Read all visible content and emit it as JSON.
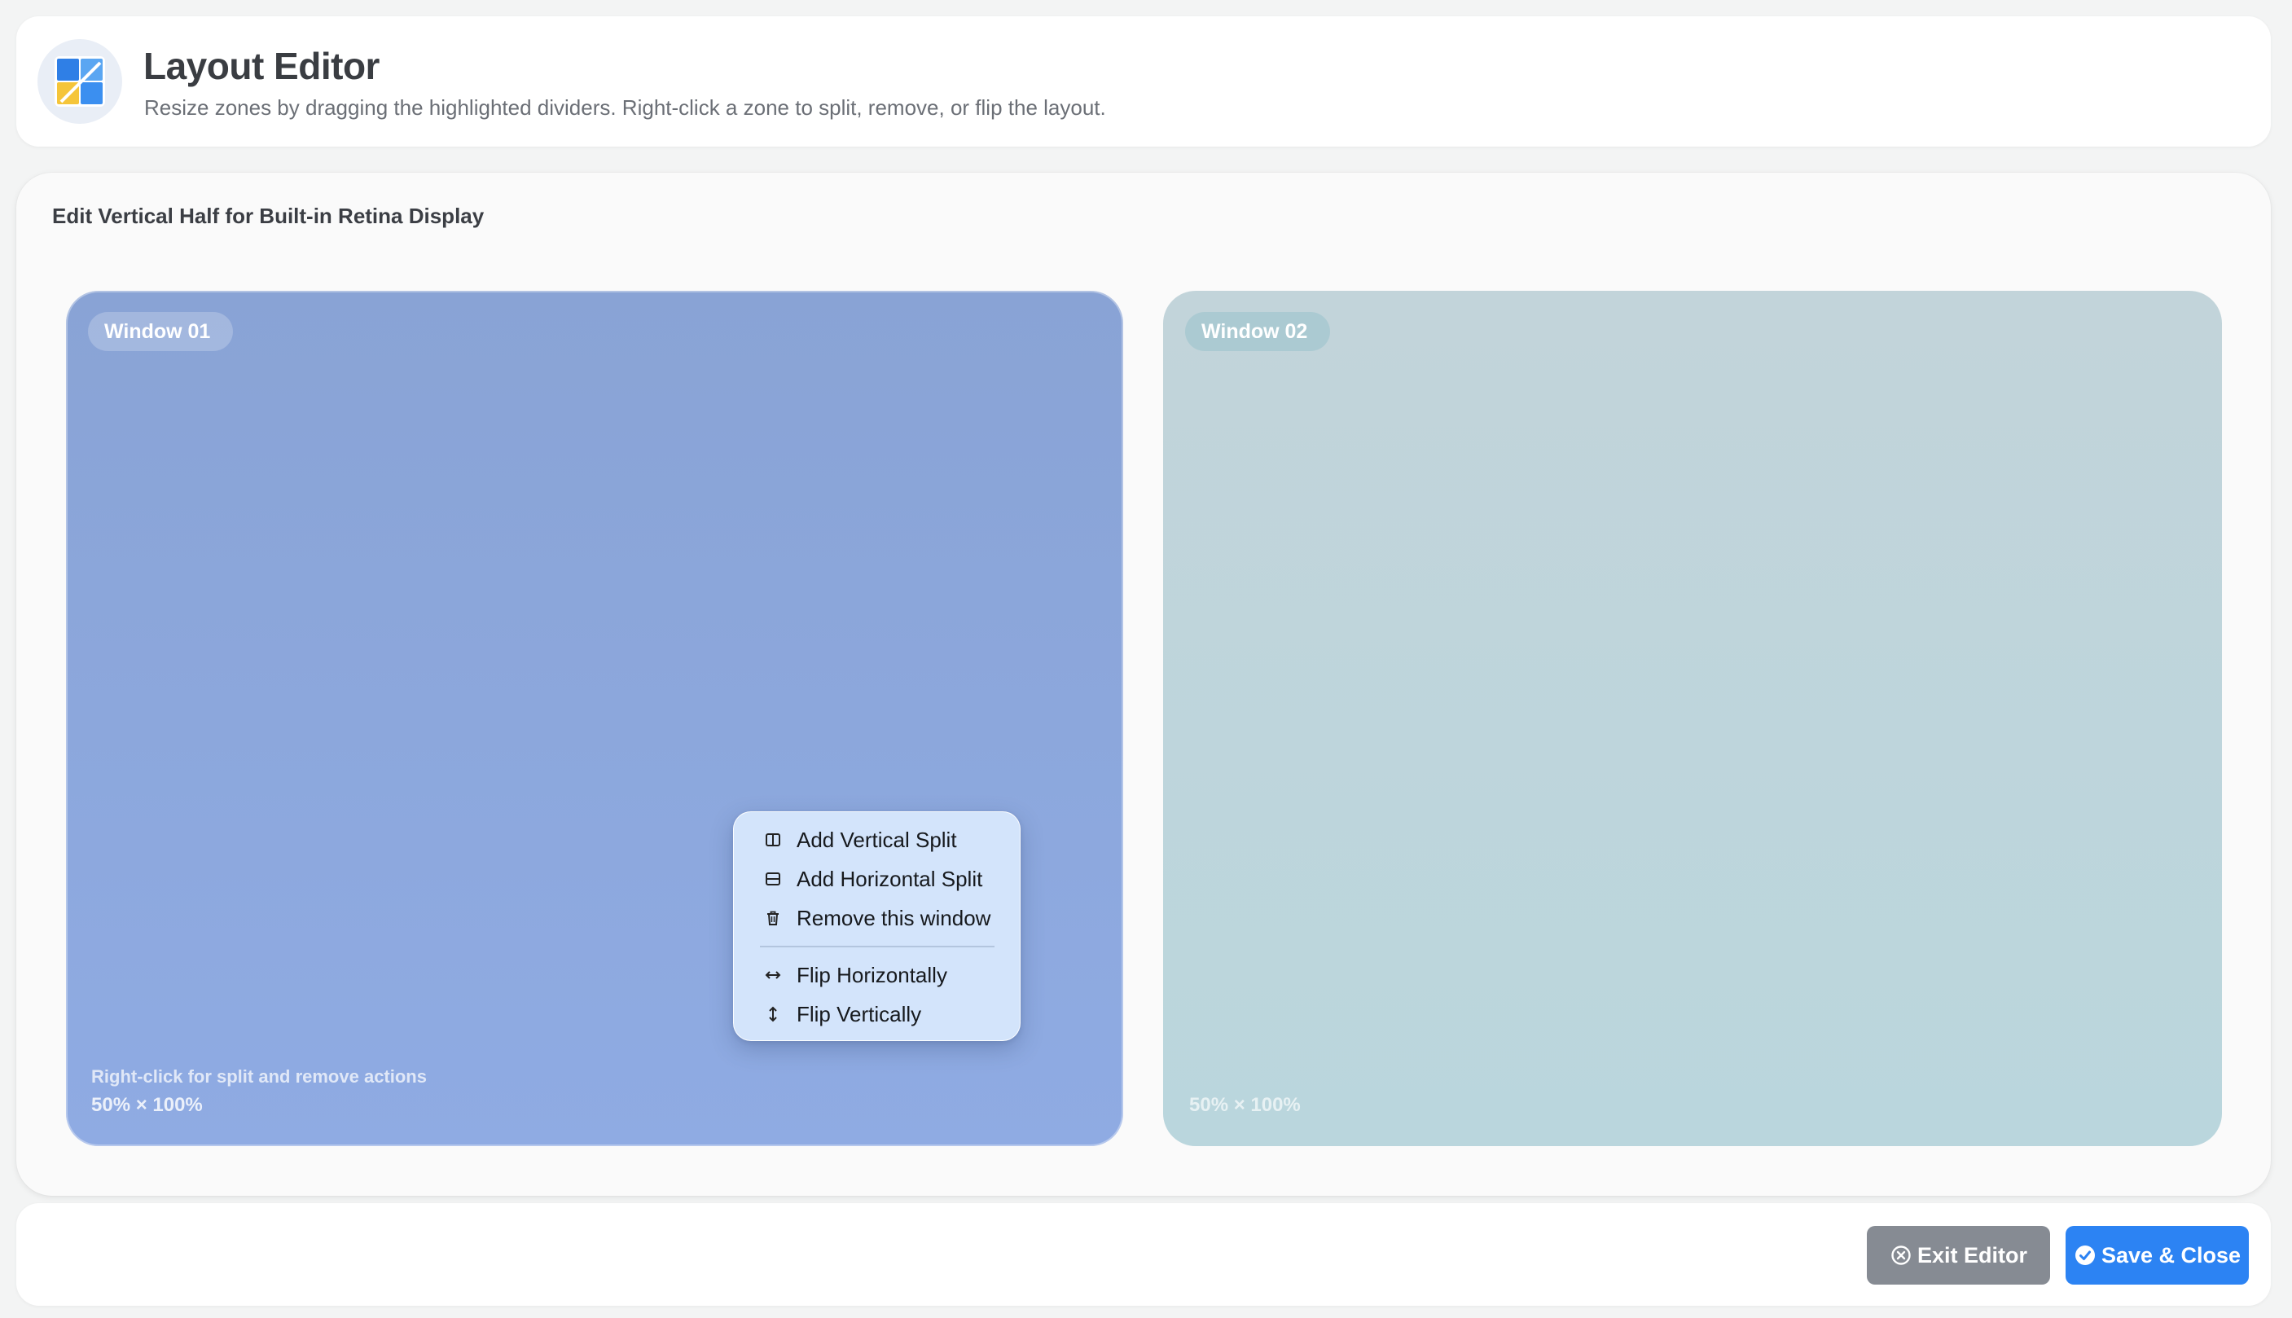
{
  "header": {
    "title": "Layout Editor",
    "subtitle": "Resize zones by dragging the highlighted dividers. Right-click a zone to split, remove, or flip the layout.",
    "icon": "layout-app-icon"
  },
  "editor": {
    "title": "Edit Vertical Half for Built-in Retina Display",
    "zones": [
      {
        "label": "Window 01",
        "hint": "Right-click for split and remove actions",
        "size": "50% × 100%",
        "color": "#8ba7dc"
      },
      {
        "label": "Window 02",
        "size": "50% × 100%",
        "color": "#bed5dc"
      }
    ]
  },
  "context_menu": {
    "items": [
      {
        "label": "Add Vertical Split",
        "icon": "vertical-split-icon"
      },
      {
        "label": "Add Horizontal Split",
        "icon": "horizontal-split-icon"
      },
      {
        "label": "Remove this window",
        "icon": "trash-icon"
      },
      {
        "label": "Flip Horizontally",
        "icon": "flip-horizontal-icon"
      },
      {
        "label": "Flip Vertically",
        "icon": "flip-vertical-icon"
      }
    ]
  },
  "footer": {
    "exit_label": "Exit Editor",
    "save_label": "Save & Close",
    "exit_color": "#868b93",
    "save_color": "#2c83f3"
  }
}
